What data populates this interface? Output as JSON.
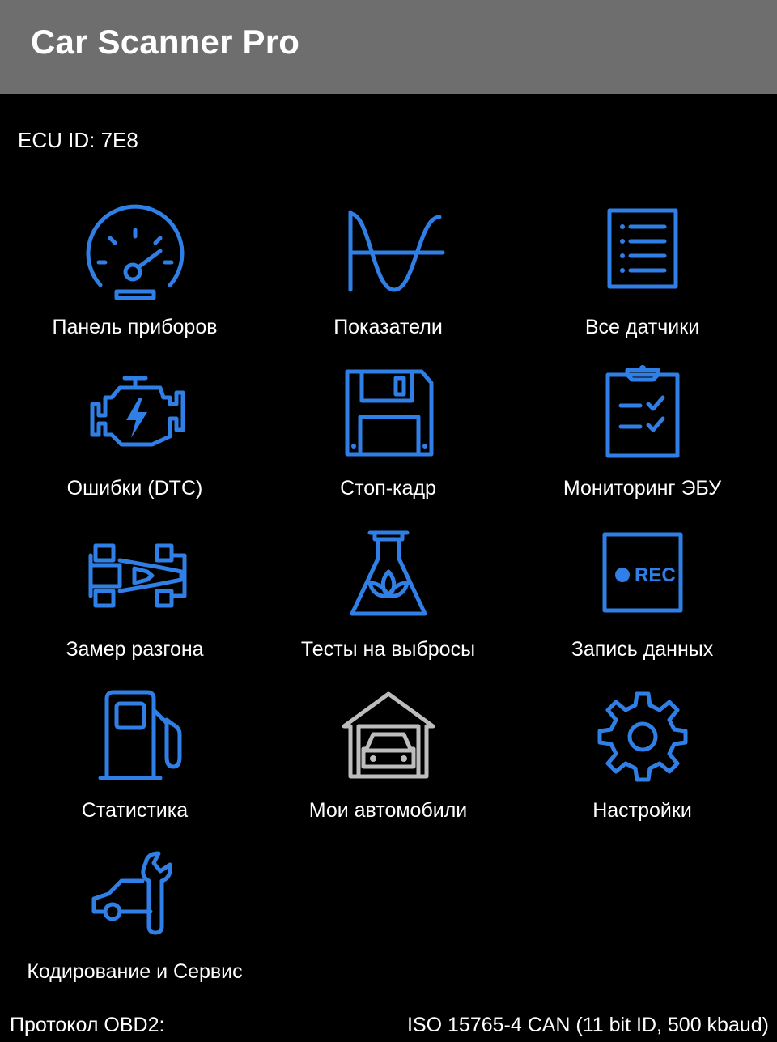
{
  "app": {
    "title": "Car Scanner Pro"
  },
  "ecu": {
    "label": "ECU ID: 7E8"
  },
  "colors": {
    "accent": "#2f7fe6",
    "appbar": "#6e6e6e",
    "background": "#000000",
    "muted_icon": "#bdbdbd"
  },
  "menu": [
    {
      "label": "Панель приборов",
      "icon": "speedometer-icon"
    },
    {
      "label": "Показатели",
      "icon": "sine-wave-icon"
    },
    {
      "label": "Все датчики",
      "icon": "list-document-icon"
    },
    {
      "label": "Ошибки (DTC)",
      "icon": "check-engine-icon"
    },
    {
      "label": "Стоп-кадр",
      "icon": "floppy-disk-icon"
    },
    {
      "label": "Мониторинг ЭБУ",
      "icon": "clipboard-check-icon"
    },
    {
      "label": "Замер разгона",
      "icon": "race-car-icon"
    },
    {
      "label": "Тесты на выбросы",
      "icon": "flask-leaf-icon"
    },
    {
      "label": "Запись данных",
      "icon": "rec-icon",
      "icon_text": "REC"
    },
    {
      "label": "Статистика",
      "icon": "fuel-pump-icon"
    },
    {
      "label": "Мои автомобили",
      "icon": "garage-car-icon"
    },
    {
      "label": "Настройки",
      "icon": "gear-icon"
    },
    {
      "label": "Кодирование и Сервис",
      "icon": "car-wrench-icon"
    }
  ],
  "footer": {
    "protocol_label": "Протокол OBD2:",
    "protocol_value": "ISO 15765-4 CAN (11 bit ID, 500 kbaud)"
  }
}
